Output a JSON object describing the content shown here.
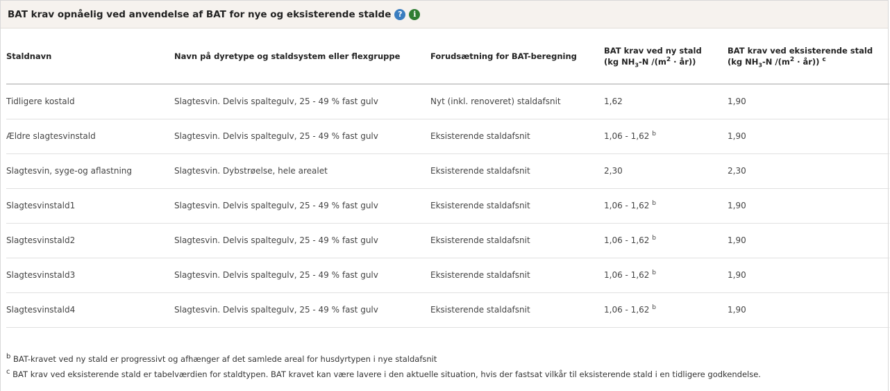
{
  "panel": {
    "title": "BAT krav opnåelig ved anvendelse af BAT for nye og eksisterende stalde",
    "help_icon": "?",
    "info_icon": "i"
  },
  "columns": {
    "c1": "Staldnavn",
    "c2": "Navn på dyretype og staldsystem eller flexgruppe",
    "c3": "Forudsætning for BAT-beregning",
    "c4_line1": "BAT krav ved ny stald",
    "c4_line2_pre": "(kg NH",
    "c4_sub": "3",
    "c4_line2_mid": "-N /(m",
    "c4_sup": "2",
    "c4_line2_post": " · år))",
    "c5_line1": "BAT krav ved eksisterende stald",
    "c5_line2_pre": "(kg NH",
    "c5_sub": "3",
    "c5_line2_mid": "-N /(m",
    "c5_sup": "2",
    "c5_line2_post": " · år))",
    "c5_note": "c"
  },
  "rows": [
    {
      "stald": "Tidligere kostald",
      "navn": "Slagtesvin. Delvis spaltegulv, 25 - 49 % fast gulv",
      "forudsaetning": "Nyt (inkl. renoveret) staldafsnit",
      "ny": "1,62",
      "ny_note": "",
      "eks": "1,90"
    },
    {
      "stald": "Ældre slagtesvinstald",
      "navn": "Slagtesvin. Delvis spaltegulv, 25 - 49 % fast gulv",
      "forudsaetning": "Eksisterende staldafsnit",
      "ny": "1,06 - 1,62",
      "ny_note": "b",
      "eks": "1,90"
    },
    {
      "stald": "Slagtesvin, syge-og aflastning",
      "navn": "Slagtesvin. Dybstrøelse, hele arealet",
      "forudsaetning": "Eksisterende staldafsnit",
      "ny": "2,30",
      "ny_note": "",
      "eks": "2,30"
    },
    {
      "stald": "Slagtesvinstald1",
      "navn": "Slagtesvin. Delvis spaltegulv, 25 - 49 % fast gulv",
      "forudsaetning": "Eksisterende staldafsnit",
      "ny": "1,06 - 1,62",
      "ny_note": "b",
      "eks": "1,90"
    },
    {
      "stald": "Slagtesvinstald2",
      "navn": "Slagtesvin. Delvis spaltegulv, 25 - 49 % fast gulv",
      "forudsaetning": "Eksisterende staldafsnit",
      "ny": "1,06 - 1,62",
      "ny_note": "b",
      "eks": "1,90"
    },
    {
      "stald": "Slagtesvinstald3",
      "navn": "Slagtesvin. Delvis spaltegulv, 25 - 49 % fast gulv",
      "forudsaetning": "Eksisterende staldafsnit",
      "ny": "1,06 - 1,62",
      "ny_note": "b",
      "eks": "1,90"
    },
    {
      "stald": "Slagtesvinstald4",
      "navn": "Slagtesvin. Delvis spaltegulv, 25 - 49 % fast gulv",
      "forudsaetning": "Eksisterende staldafsnit",
      "ny": "1,06 - 1,62",
      "ny_note": "b",
      "eks": "1,90"
    }
  ],
  "footnotes": [
    {
      "mark": "b",
      "text": " BAT-kravet ved ny stald er progressivt og afhænger af det samlede areal for husdyrtypen i nye staldafsnit"
    },
    {
      "mark": "c",
      "text": " BAT krav ved eksisterende stald er tabelværdien for staldtypen. BAT kravet kan være lavere i den aktuelle situation, hvis der fastsat vilkår til eksisterende stald i en tidligere godkendelse."
    }
  ]
}
